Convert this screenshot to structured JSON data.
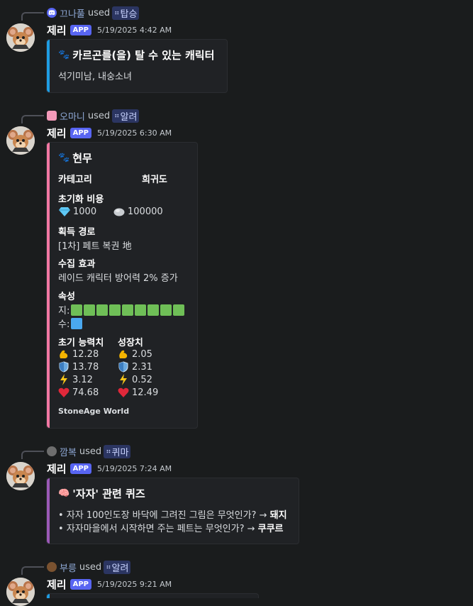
{
  "colors": {
    "app_badge": "#5865f2",
    "bar_blue": "#1e9de3",
    "bar_pink": "#f277a2",
    "bar_purple": "#9b59b6",
    "attr_green": "#6fbf57",
    "attr_blue": "#4aa8f0"
  },
  "messages": [
    {
      "reply": {
        "icon": "discord-icon",
        "name": "끄나풀",
        "used": "used",
        "command": "탑승"
      },
      "user": "제리",
      "badge": "APP",
      "timestamp": "5/19/2025 4:42 AM",
      "embed": {
        "title_icon": "paw-icon",
        "title": "카르곤를(을) 탈 수 있는 캐릭터",
        "description": "석기미남, 내숭소녀"
      }
    },
    {
      "reply": {
        "icon": "pink-avatar-icon",
        "name": "오마니",
        "used": "used",
        "command": "알려"
      },
      "user": "제리",
      "badge": "APP",
      "timestamp": "5/19/2025 6:30 AM",
      "embed": {
        "title": "현무",
        "category_label": "카테고리",
        "rarity_label": "희귀도",
        "cost_label": "초기화 비용",
        "cost_gem": "1000",
        "cost_stone": "100000",
        "route_label": "획득 경로",
        "route_value": "[1차] 페트 복권 地",
        "effect_label": "수집 효과",
        "effect_value": "레이드 캐릭터 방어력 2% 증가",
        "attr_label": "속성",
        "attr_earth_label": "지:",
        "attr_earth_count": 9,
        "attr_water_label": "수:",
        "attr_water_count": 1,
        "initial_label": "초기 능력치",
        "growth_label": "성장치",
        "initial": [
          "12.28",
          "13.78",
          "3.12",
          "74.68"
        ],
        "growth": [
          "2.05",
          "2.31",
          "0.52",
          "12.49"
        ],
        "footer": "StoneAge World"
      }
    },
    {
      "reply": {
        "icon": "animal-avatar-icon",
        "name": "깜복",
        "used": "used",
        "command": "퀴마"
      },
      "user": "제리",
      "badge": "APP",
      "timestamp": "5/19/2025 7:24 AM",
      "embed": {
        "title": "'자자' 관련 퀴즈",
        "q1": "• 자자 100인도장 바닥에 그려진 그림은 무엇인가? → ",
        "a1": "돼지",
        "q2": "• 자자마을에서 시작하면 주는 페트는 무엇인가? → ",
        "a2": "쿠쿠르"
      }
    },
    {
      "reply": {
        "icon": "brown-avatar-icon",
        "name": "부릉",
        "used": "used",
        "command": "알려"
      },
      "user": "제리",
      "badge": "APP",
      "timestamp": "5/19/2025 9:21 AM"
    }
  ]
}
